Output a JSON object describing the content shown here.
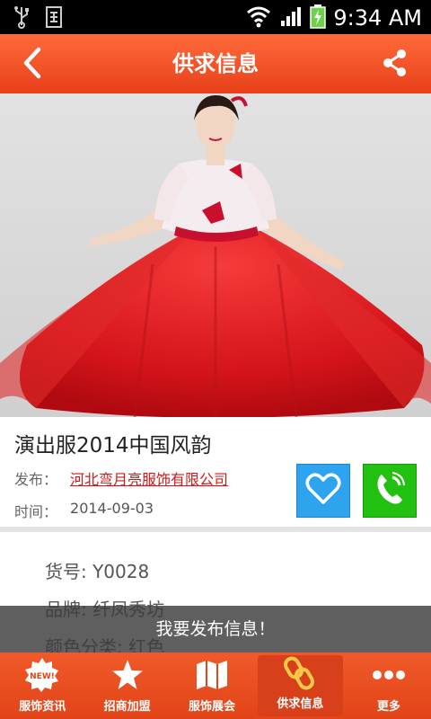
{
  "status_bar": {
    "time": "9:34 AM"
  },
  "header": {
    "title": "供求信息"
  },
  "product": {
    "title": "演出服2014中国风韵",
    "publisher_label": "发布：",
    "publisher_name": "河北弯月亮服饰有限公司",
    "time_label": "时间：",
    "time_value": "2014-09-03"
  },
  "details": {
    "item_no": "货号: Y0028",
    "brand": "品牌: 纤凤秀坊",
    "color": "颜色分类: 红色"
  },
  "toast": {
    "text": "我要发布信息！"
  },
  "bottom_nav": {
    "items": [
      {
        "label": "服饰资讯",
        "icon": "new-badge-icon"
      },
      {
        "label": "招商加盟",
        "icon": "star-icon"
      },
      {
        "label": "服饰展会",
        "icon": "map-icon"
      },
      {
        "label": "供求信息",
        "icon": "chain-link-icon",
        "active": true
      },
      {
        "label": "更多",
        "icon": "more-dots-icon"
      }
    ]
  },
  "colors": {
    "header": "#e8401a",
    "favorite": "#2ea4ef",
    "call": "#22c010",
    "link": "#d01818"
  }
}
